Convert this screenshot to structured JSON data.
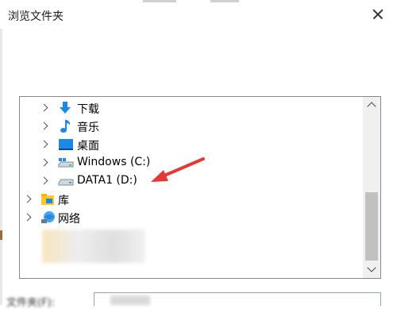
{
  "window": {
    "title": "浏览文件夹"
  },
  "tree": {
    "items": [
      {
        "label": "下载",
        "icon": "download-arrow-icon"
      },
      {
        "label": "音乐",
        "icon": "music-note-icon"
      },
      {
        "label": "桌面",
        "icon": "desktop-icon"
      },
      {
        "label": "Windows (C:)",
        "icon": "system-drive-icon"
      },
      {
        "label": "DATA1 (D:)",
        "icon": "hard-drive-icon"
      },
      {
        "label": "库",
        "icon": "library-icon"
      },
      {
        "label": "网络",
        "icon": "network-icon"
      }
    ]
  },
  "footer": {
    "folder_label": "文件夹(F):"
  },
  "colors": {
    "annotation_arrow": "#e53935",
    "folder_blue": "#1e88e5",
    "selection_border": "#828790"
  }
}
